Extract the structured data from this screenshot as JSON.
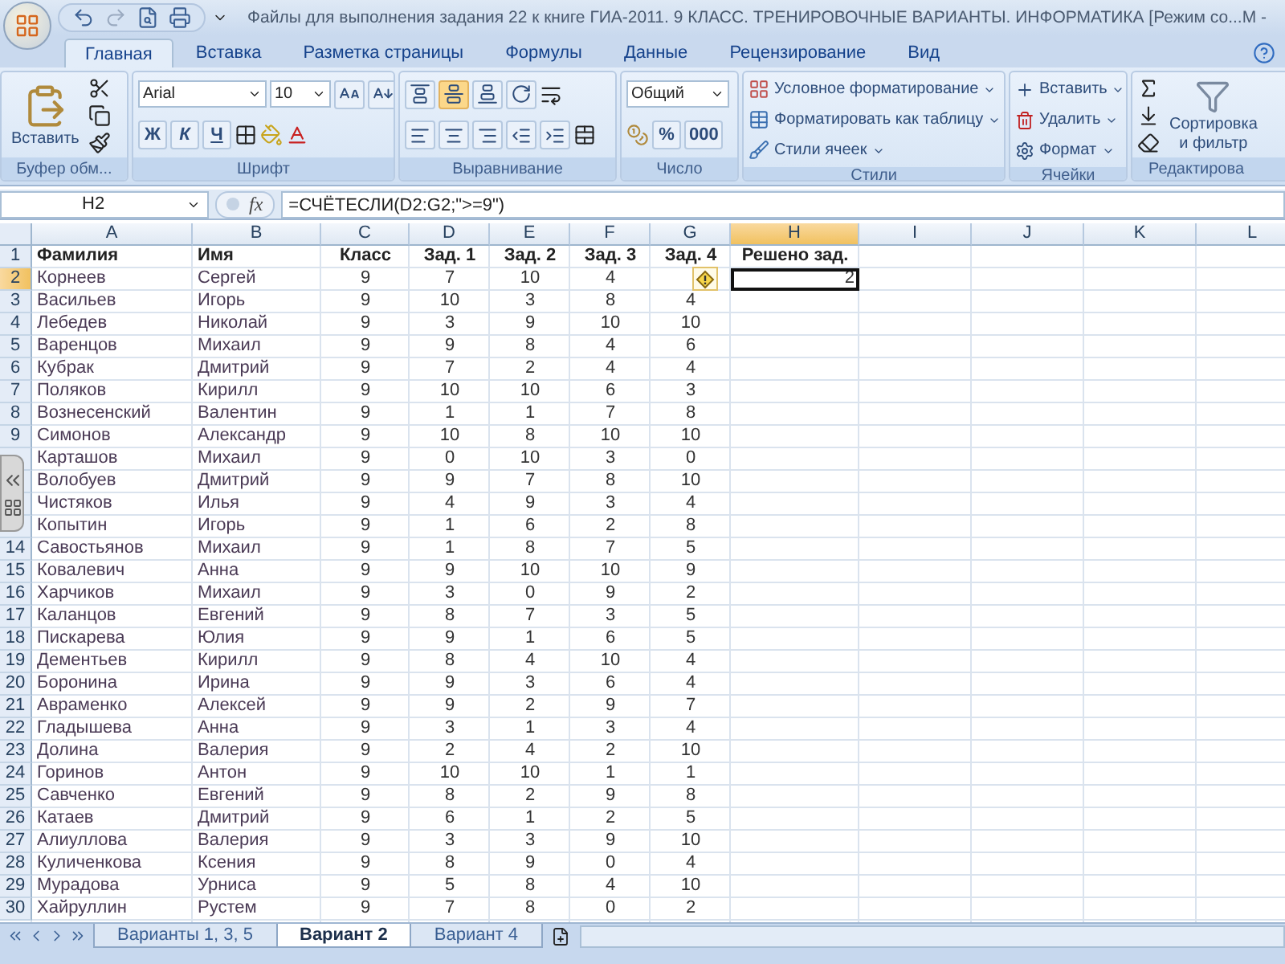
{
  "window": {
    "title": "Файлы для выполнения задания 22 к книге ГИА-2011. 9 КЛАСС. ТРЕНИРОВОЧНЫЕ ВАРИАНТЫ. ИНФОРМАТИКА  [Режим со...M -"
  },
  "tabs": [
    {
      "label": "Главная",
      "selected": true
    },
    {
      "label": "Вставка",
      "selected": false
    },
    {
      "label": "Разметка страницы",
      "selected": false
    },
    {
      "label": "Формулы",
      "selected": false
    },
    {
      "label": "Данные",
      "selected": false
    },
    {
      "label": "Рецензирование",
      "selected": false
    },
    {
      "label": "Вид",
      "selected": false
    }
  ],
  "ribbon": {
    "clipboard": {
      "paste": "Вставить",
      "label": "Буфер обм..."
    },
    "font": {
      "name": "Arial",
      "size": "10",
      "bold": "Ж",
      "italic": "К",
      "underline": "Ч",
      "label": "Шрифт"
    },
    "alignment": {
      "vertical": [
        {
          "selected": false
        },
        {
          "selected": true
        },
        {
          "selected": false
        }
      ],
      "label": "Выравнивание"
    },
    "number": {
      "format": "Общий",
      "percent": "%",
      "thousands": "000",
      "label": "Число"
    },
    "styles": {
      "items": [
        "Условное форматирование",
        "Форматировать как таблицу",
        "Стили ячеек"
      ],
      "label": "Стили"
    },
    "cells": {
      "items": [
        "Вставить",
        "Удалить",
        "Формат"
      ],
      "label": "Ячейки"
    },
    "editing": {
      "sort": [
        "Сортировка",
        "и фильтр"
      ],
      "label": "Редактирова"
    }
  },
  "formula_bar": {
    "name_box": "H2",
    "fx": "fx",
    "formula": "=СЧЁТЕСЛИ(D2:G2;\">=9\")"
  },
  "sheet": {
    "columns": [
      {
        "label": "A",
        "selected": false
      },
      {
        "label": "B",
        "selected": false
      },
      {
        "label": "C",
        "selected": false
      },
      {
        "label": "D",
        "selected": false
      },
      {
        "label": "E",
        "selected": false
      },
      {
        "label": "F",
        "selected": false
      },
      {
        "label": "G",
        "selected": false
      },
      {
        "label": "H",
        "selected": true
      },
      {
        "label": "I",
        "selected": false
      },
      {
        "label": "J",
        "selected": false
      },
      {
        "label": "K",
        "selected": false
      },
      {
        "label": "L",
        "selected": false
      }
    ],
    "rows": [
      {
        "num": "1",
        "selected": false,
        "cells": [
          "Фамилия",
          "Имя",
          "Класс",
          "Зад. 1",
          "Зад. 2",
          "Зад. 3",
          "Зад. 4",
          "Решено зад."
        ]
      },
      {
        "num": "2",
        "selected": true,
        "cells": [
          "Корнеев",
          "Сергей",
          "9",
          "7",
          "10",
          "4",
          null,
          "2"
        ]
      },
      {
        "num": "3",
        "selected": false,
        "cells": [
          "Васильев",
          "Игорь",
          "9",
          "10",
          "3",
          "8",
          "4"
        ]
      },
      {
        "num": "4",
        "selected": false,
        "cells": [
          "Лебедев",
          "Николай",
          "9",
          "3",
          "9",
          "10",
          "10"
        ]
      },
      {
        "num": "5",
        "selected": false,
        "cells": [
          "Варенцов",
          "Михаил",
          "9",
          "9",
          "8",
          "4",
          "6"
        ]
      },
      {
        "num": "6",
        "selected": false,
        "cells": [
          "Кубрак",
          "Дмитрий",
          "9",
          "7",
          "2",
          "4",
          "4"
        ]
      },
      {
        "num": "7",
        "selected": false,
        "cells": [
          "Поляков",
          "Кирилл",
          "9",
          "10",
          "10",
          "6",
          "3"
        ]
      },
      {
        "num": "8",
        "selected": false,
        "cells": [
          "Вознесенский",
          "Валентин",
          "9",
          "1",
          "1",
          "7",
          "8"
        ]
      },
      {
        "num": "9",
        "selected": false,
        "cells": [
          "Симонов",
          "Александр",
          "9",
          "10",
          "8",
          "10",
          "10"
        ]
      },
      {
        "selected": false,
        "cells": [
          "Карташов",
          "Михаил",
          "9",
          "0",
          "10",
          "3",
          "0"
        ]
      },
      {
        "selected": false,
        "cells": [
          "Волобуев",
          "Дмитрий",
          "9",
          "9",
          "7",
          "8",
          "10"
        ]
      },
      {
        "selected": false,
        "cells": [
          "Чистяков",
          "Илья",
          "9",
          "4",
          "9",
          "3",
          "4"
        ]
      },
      {
        "selected": false,
        "cells": [
          "Копытин",
          "Игорь",
          "9",
          "1",
          "6",
          "2",
          "8"
        ]
      },
      {
        "num": "14",
        "selected": false,
        "cells": [
          "Савостьянов",
          "Михаил",
          "9",
          "1",
          "8",
          "7",
          "5"
        ]
      },
      {
        "num": "15",
        "selected": false,
        "cells": [
          "Ковалевич",
          "Анна",
          "9",
          "9",
          "10",
          "10",
          "9"
        ]
      },
      {
        "num": "16",
        "selected": false,
        "cells": [
          "Харчиков",
          "Михаил",
          "9",
          "3",
          "0",
          "9",
          "2"
        ]
      },
      {
        "num": "17",
        "selected": false,
        "cells": [
          "Каланцов",
          "Евгений",
          "9",
          "8",
          "7",
          "3",
          "5"
        ]
      },
      {
        "num": "18",
        "selected": false,
        "cells": [
          "Пискарева",
          "Юлия",
          "9",
          "9",
          "1",
          "6",
          "5"
        ]
      },
      {
        "num": "19",
        "selected": false,
        "cells": [
          "Дементьев",
          "Кирилл",
          "9",
          "8",
          "4",
          "10",
          "4"
        ]
      },
      {
        "num": "20",
        "selected": false,
        "cells": [
          "Боронина",
          "Ирина",
          "9",
          "9",
          "3",
          "6",
          "4"
        ]
      },
      {
        "num": "21",
        "selected": false,
        "cells": [
          "Авраменко",
          "Алексей",
          "9",
          "9",
          "2",
          "9",
          "7"
        ]
      },
      {
        "num": "22",
        "selected": false,
        "cells": [
          "Гладышева",
          "Анна",
          "9",
          "3",
          "1",
          "3",
          "4"
        ]
      },
      {
        "num": "23",
        "selected": false,
        "cells": [
          "Долина",
          "Валерия",
          "9",
          "2",
          "4",
          "2",
          "10"
        ]
      },
      {
        "num": "24",
        "selected": false,
        "cells": [
          "Горинов",
          "Антон",
          "9",
          "10",
          "10",
          "1",
          "1"
        ]
      },
      {
        "num": "25",
        "selected": false,
        "cells": [
          "Савченко",
          "Евгений",
          "9",
          "8",
          "2",
          "9",
          "8"
        ]
      },
      {
        "num": "26",
        "selected": false,
        "cells": [
          "Катаев",
          "Дмитрий",
          "9",
          "6",
          "1",
          "2",
          "5"
        ]
      },
      {
        "num": "27",
        "selected": false,
        "cells": [
          "Алиуллова",
          "Валерия",
          "9",
          "3",
          "3",
          "9",
          "10"
        ]
      },
      {
        "num": "28",
        "selected": false,
        "cells": [
          "Куличенкова",
          "Ксения",
          "9",
          "8",
          "9",
          "0",
          "4"
        ]
      },
      {
        "num": "29",
        "selected": false,
        "cells": [
          "Мурадова",
          "Урниса",
          "9",
          "5",
          "8",
          "4",
          "10"
        ]
      },
      {
        "num": "30",
        "selected": false,
        "cells": [
          "Хайруллин",
          "Рустем",
          "9",
          "7",
          "8",
          "0",
          "2"
        ]
      }
    ]
  },
  "sheet_tabs": [
    {
      "label": "Варианты 1, 3, 5",
      "selected": false
    },
    {
      "label": "Вариант 2",
      "selected": true
    },
    {
      "label": "Вариант 4",
      "selected": false
    }
  ]
}
